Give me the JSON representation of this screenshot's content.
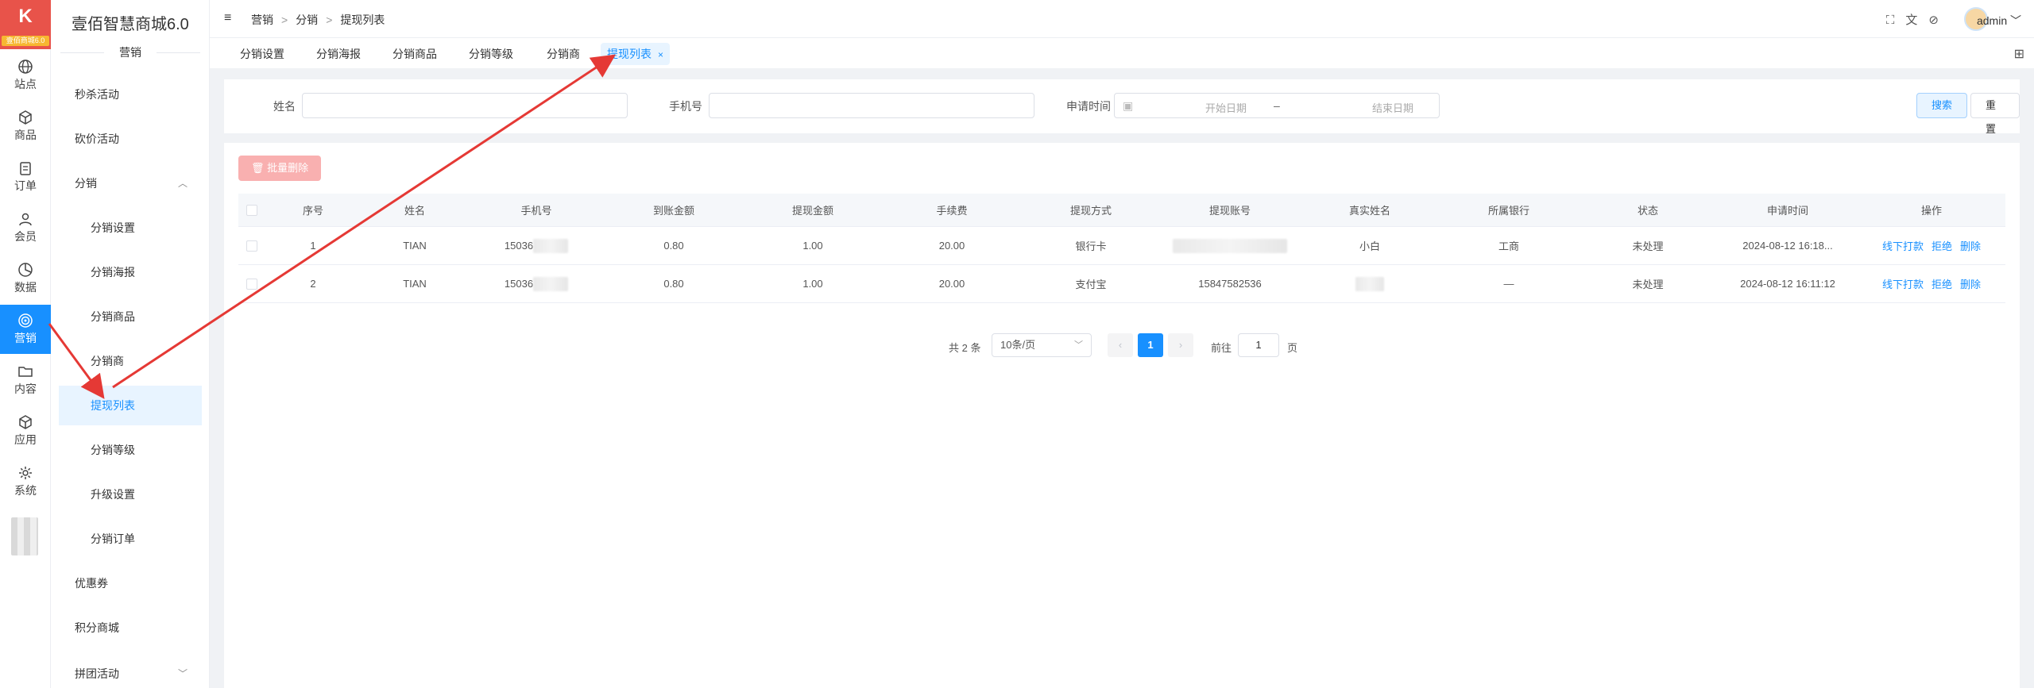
{
  "app": {
    "title": "壹佰智慧商城6.0",
    "logo_text": "K",
    "logo_badge": "壹佰商城6.0",
    "section_title": "营销"
  },
  "rail": [
    {
      "label": "站点",
      "icon": "globe-icon"
    },
    {
      "label": "商品",
      "icon": "box-icon"
    },
    {
      "label": "订单",
      "icon": "clipboard-icon"
    },
    {
      "label": "会员",
      "icon": "user-icon"
    },
    {
      "label": "数据",
      "icon": "pie-chart-icon"
    },
    {
      "label": "营销",
      "icon": "target-icon",
      "active": true
    },
    {
      "label": "内容",
      "icon": "folder-icon"
    },
    {
      "label": "应用",
      "icon": "cube-icon"
    },
    {
      "label": "系统",
      "icon": "gear-icon"
    }
  ],
  "submenu": [
    {
      "label": "秒杀活动"
    },
    {
      "label": "砍价活动"
    },
    {
      "label": "分销",
      "expanded": true
    },
    {
      "label": "分销设置"
    },
    {
      "label": "分销海报"
    },
    {
      "label": "分销商品"
    },
    {
      "label": "分销商"
    },
    {
      "label": "提现列表",
      "active": true
    },
    {
      "label": "分销等级"
    },
    {
      "label": "升级设置"
    },
    {
      "label": "分销订单"
    },
    {
      "label": "优惠券"
    },
    {
      "label": "积分商城"
    },
    {
      "label": "拼团活动"
    }
  ],
  "breadcrumb": [
    "营销",
    "分销",
    "提现列表"
  ],
  "header": {
    "user": "admin"
  },
  "tabs": [
    {
      "label": "分销设置"
    },
    {
      "label": "分销海报"
    },
    {
      "label": "分销商品"
    },
    {
      "label": "分销等级"
    },
    {
      "label": "分销商"
    },
    {
      "label": "提现列表",
      "active": true,
      "close": "×"
    }
  ],
  "search": {
    "name_label": "姓名",
    "phone_label": "手机号",
    "time_label": "申请时间",
    "start_placeholder": "开始日期",
    "range_sep": "–",
    "end_placeholder": "结束日期",
    "search_button": "搜索",
    "reset_button": "重置"
  },
  "batch_delete": "批量删除",
  "table": {
    "columns": [
      "序号",
      "姓名",
      "手机号",
      "到账金额",
      "提现金额",
      "手续费",
      "提现方式",
      "提现账号",
      "真实姓名",
      "所属银行",
      "状态",
      "申请时间",
      "操作"
    ],
    "rows": [
      {
        "index": "1",
        "name": "TIAN",
        "phone": "15036",
        "received": "0.80",
        "amount": "1.00",
        "fee": "20.00",
        "method": "银行卡",
        "account": "",
        "real_name": "小白",
        "bank": "工商",
        "status": "未处理",
        "time": "2024-08-12 16:18..."
      },
      {
        "index": "2",
        "name": "TIAN",
        "phone": "15036",
        "received": "0.80",
        "amount": "1.00",
        "fee": "20.00",
        "method": "支付宝",
        "account": "15847582536",
        "real_name": "",
        "bank": "—",
        "status": "未处理",
        "time": "2024-08-12 16:11:12"
      }
    ],
    "actions": [
      "线下打款",
      "拒绝",
      "删除"
    ]
  },
  "pagination": {
    "total": "共 2 条",
    "page_size": "10条/页",
    "current": "1",
    "prev": "‹",
    "next": "›",
    "goto_label": "前往",
    "goto_value": "1",
    "page_suffix": "页"
  },
  "colors": {
    "accent": "#1890ff",
    "annotation": "#e53935",
    "logo": "#e8534a"
  }
}
